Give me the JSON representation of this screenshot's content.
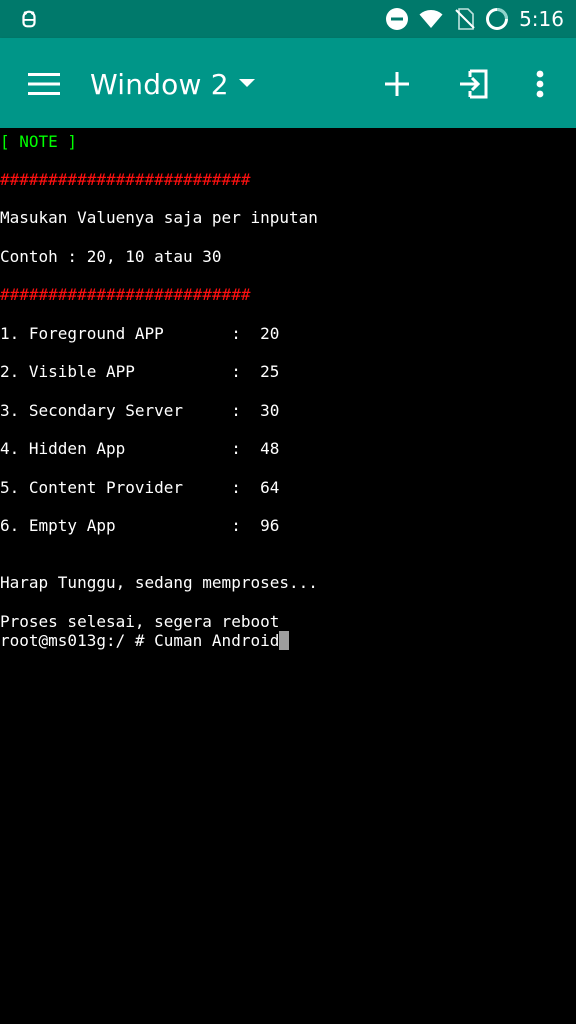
{
  "status_bar": {
    "time": "5:16",
    "icons": [
      "android-debug-icon",
      "do-not-disturb-icon",
      "wifi-icon",
      "no-sim-icon",
      "battery-icon"
    ]
  },
  "toolbar": {
    "title": "Window 2",
    "icons": [
      "menu-icon",
      "dropdown-arrow-icon",
      "add-icon",
      "exit-icon",
      "more-vert-icon"
    ]
  },
  "terminal": {
    "note_header": "[ NOTE ]",
    "divider": "##########################",
    "instruction": "Masukan Valuenya saja per inputan",
    "example": "Contoh : 20, 10 atau 30",
    "items": [
      {
        "label": "1. Foreground APP       :",
        "value": "20"
      },
      {
        "label": "2. Visible APP          :",
        "value": "25"
      },
      {
        "label": "3. Secondary Server     :",
        "value": "30"
      },
      {
        "label": "4. Hidden App           :",
        "value": "48"
      },
      {
        "label": "5. Content Provider     :",
        "value": "64"
      },
      {
        "label": "6. Empty App            :",
        "value": "96"
      }
    ],
    "waiting": "Harap Tunggu, sedang memproses...",
    "done": "Proses selesai, segera reboot",
    "prompt": "root@ms013g:/ # ",
    "command": "Cuman Android"
  },
  "colors": {
    "status_bar": "#00796b",
    "toolbar": "#009688",
    "note": "#00ff00",
    "divider": "#ff1010",
    "cursor": "#9e9e9e"
  }
}
